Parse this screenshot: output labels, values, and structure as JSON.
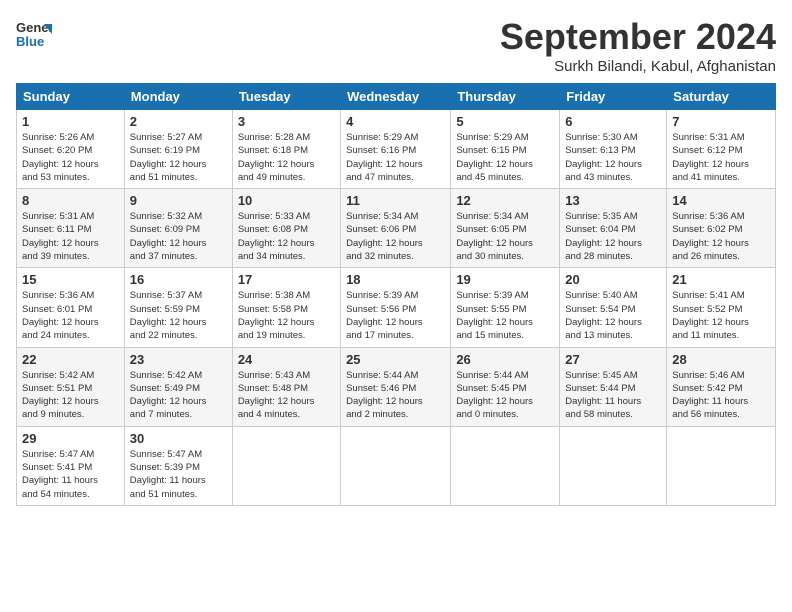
{
  "header": {
    "logo_line1": "General",
    "logo_line2": "Blue",
    "month": "September 2024",
    "location": "Surkh Bilandi, Kabul, Afghanistan"
  },
  "weekdays": [
    "Sunday",
    "Monday",
    "Tuesday",
    "Wednesday",
    "Thursday",
    "Friday",
    "Saturday"
  ],
  "weeks": [
    [
      {
        "day": "1",
        "info": "Sunrise: 5:26 AM\nSunset: 6:20 PM\nDaylight: 12 hours\nand 53 minutes."
      },
      {
        "day": "2",
        "info": "Sunrise: 5:27 AM\nSunset: 6:19 PM\nDaylight: 12 hours\nand 51 minutes."
      },
      {
        "day": "3",
        "info": "Sunrise: 5:28 AM\nSunset: 6:18 PM\nDaylight: 12 hours\nand 49 minutes."
      },
      {
        "day": "4",
        "info": "Sunrise: 5:29 AM\nSunset: 6:16 PM\nDaylight: 12 hours\nand 47 minutes."
      },
      {
        "day": "5",
        "info": "Sunrise: 5:29 AM\nSunset: 6:15 PM\nDaylight: 12 hours\nand 45 minutes."
      },
      {
        "day": "6",
        "info": "Sunrise: 5:30 AM\nSunset: 6:13 PM\nDaylight: 12 hours\nand 43 minutes."
      },
      {
        "day": "7",
        "info": "Sunrise: 5:31 AM\nSunset: 6:12 PM\nDaylight: 12 hours\nand 41 minutes."
      }
    ],
    [
      {
        "day": "8",
        "info": "Sunrise: 5:31 AM\nSunset: 6:11 PM\nDaylight: 12 hours\nand 39 minutes."
      },
      {
        "day": "9",
        "info": "Sunrise: 5:32 AM\nSunset: 6:09 PM\nDaylight: 12 hours\nand 37 minutes."
      },
      {
        "day": "10",
        "info": "Sunrise: 5:33 AM\nSunset: 6:08 PM\nDaylight: 12 hours\nand 34 minutes."
      },
      {
        "day": "11",
        "info": "Sunrise: 5:34 AM\nSunset: 6:06 PM\nDaylight: 12 hours\nand 32 minutes."
      },
      {
        "day": "12",
        "info": "Sunrise: 5:34 AM\nSunset: 6:05 PM\nDaylight: 12 hours\nand 30 minutes."
      },
      {
        "day": "13",
        "info": "Sunrise: 5:35 AM\nSunset: 6:04 PM\nDaylight: 12 hours\nand 28 minutes."
      },
      {
        "day": "14",
        "info": "Sunrise: 5:36 AM\nSunset: 6:02 PM\nDaylight: 12 hours\nand 26 minutes."
      }
    ],
    [
      {
        "day": "15",
        "info": "Sunrise: 5:36 AM\nSunset: 6:01 PM\nDaylight: 12 hours\nand 24 minutes."
      },
      {
        "day": "16",
        "info": "Sunrise: 5:37 AM\nSunset: 5:59 PM\nDaylight: 12 hours\nand 22 minutes."
      },
      {
        "day": "17",
        "info": "Sunrise: 5:38 AM\nSunset: 5:58 PM\nDaylight: 12 hours\nand 19 minutes."
      },
      {
        "day": "18",
        "info": "Sunrise: 5:39 AM\nSunset: 5:56 PM\nDaylight: 12 hours\nand 17 minutes."
      },
      {
        "day": "19",
        "info": "Sunrise: 5:39 AM\nSunset: 5:55 PM\nDaylight: 12 hours\nand 15 minutes."
      },
      {
        "day": "20",
        "info": "Sunrise: 5:40 AM\nSunset: 5:54 PM\nDaylight: 12 hours\nand 13 minutes."
      },
      {
        "day": "21",
        "info": "Sunrise: 5:41 AM\nSunset: 5:52 PM\nDaylight: 12 hours\nand 11 minutes."
      }
    ],
    [
      {
        "day": "22",
        "info": "Sunrise: 5:42 AM\nSunset: 5:51 PM\nDaylight: 12 hours\nand 9 minutes."
      },
      {
        "day": "23",
        "info": "Sunrise: 5:42 AM\nSunset: 5:49 PM\nDaylight: 12 hours\nand 7 minutes."
      },
      {
        "day": "24",
        "info": "Sunrise: 5:43 AM\nSunset: 5:48 PM\nDaylight: 12 hours\nand 4 minutes."
      },
      {
        "day": "25",
        "info": "Sunrise: 5:44 AM\nSunset: 5:46 PM\nDaylight: 12 hours\nand 2 minutes."
      },
      {
        "day": "26",
        "info": "Sunrise: 5:44 AM\nSunset: 5:45 PM\nDaylight: 12 hours\nand 0 minutes."
      },
      {
        "day": "27",
        "info": "Sunrise: 5:45 AM\nSunset: 5:44 PM\nDaylight: 11 hours\nand 58 minutes."
      },
      {
        "day": "28",
        "info": "Sunrise: 5:46 AM\nSunset: 5:42 PM\nDaylight: 11 hours\nand 56 minutes."
      }
    ],
    [
      {
        "day": "29",
        "info": "Sunrise: 5:47 AM\nSunset: 5:41 PM\nDaylight: 11 hours\nand 54 minutes."
      },
      {
        "day": "30",
        "info": "Sunrise: 5:47 AM\nSunset: 5:39 PM\nDaylight: 11 hours\nand 51 minutes."
      },
      {
        "day": "",
        "info": ""
      },
      {
        "day": "",
        "info": ""
      },
      {
        "day": "",
        "info": ""
      },
      {
        "day": "",
        "info": ""
      },
      {
        "day": "",
        "info": ""
      }
    ]
  ]
}
